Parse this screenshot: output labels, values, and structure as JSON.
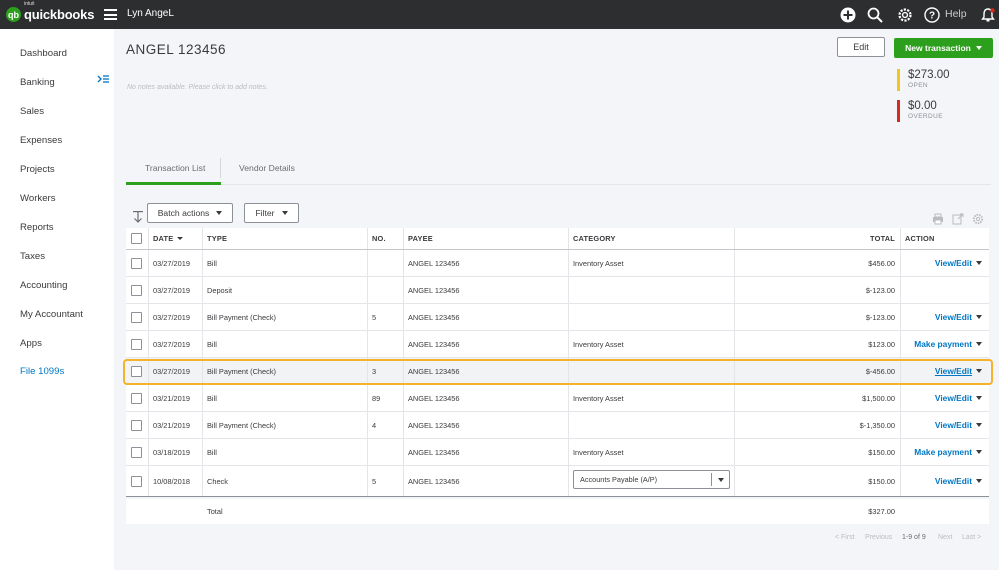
{
  "topbar": {
    "logo_small": "intuit",
    "logo_main": "quickbooks",
    "company": "Lyn AngeL",
    "help_label": "Help",
    "icons": [
      "plus-circle-icon",
      "search-icon",
      "gear-icon",
      "help-icon",
      "bell-icon"
    ]
  },
  "sidebar": {
    "items": [
      {
        "label": "Dashboard"
      },
      {
        "label": "Banking"
      },
      {
        "label": "Sales"
      },
      {
        "label": "Expenses"
      },
      {
        "label": "Projects"
      },
      {
        "label": "Workers"
      },
      {
        "label": "Reports"
      },
      {
        "label": "Taxes"
      },
      {
        "label": "Accounting"
      },
      {
        "label": "My Accountant"
      },
      {
        "label": "Apps"
      },
      {
        "label": "File 1099s"
      }
    ]
  },
  "vendor": {
    "name": "ANGEL 123456",
    "notes_placeholder": "No notes available. Please click to add notes.",
    "edit_label": "Edit",
    "new_transaction_label": "New transaction",
    "open_amount": "$273.00",
    "open_label": "OPEN",
    "overdue_amount": "$0.00",
    "overdue_label": "OVERDUE"
  },
  "colors": {
    "brand_green": "#2ca01c",
    "link_blue": "#0077c5",
    "open_bar": "#f5c518",
    "overdue_bar": "#d52b1e",
    "highlight": "#f5b22b"
  },
  "tabs": [
    {
      "label": "Transaction List"
    },
    {
      "label": "Vendor Details"
    }
  ],
  "toolbar": {
    "batch_label": "Batch actions",
    "filter_label": "Filter"
  },
  "table": {
    "headers": {
      "date": "DATE",
      "type": "TYPE",
      "no": "NO.",
      "payee": "PAYEE",
      "category": "CATEGORY",
      "total": "TOTAL",
      "action": "ACTION"
    },
    "rows": [
      {
        "date": "03/27/2019",
        "type": "Bill",
        "no": "",
        "payee": "ANGEL 123456",
        "category": "Inventory Asset",
        "total": "$456.00",
        "action": "View/Edit"
      },
      {
        "date": "03/27/2019",
        "type": "Deposit",
        "no": "",
        "payee": "ANGEL 123456",
        "category": "",
        "total": "$-123.00",
        "action": ""
      },
      {
        "date": "03/27/2019",
        "type": "Bill Payment (Check)",
        "no": "5",
        "payee": "ANGEL 123456",
        "category": "",
        "total": "$-123.00",
        "action": "View/Edit"
      },
      {
        "date": "03/27/2019",
        "type": "Bill",
        "no": "",
        "payee": "ANGEL 123456",
        "category": "Inventory Asset",
        "total": "$123.00",
        "action": "Make payment"
      },
      {
        "date": "03/27/2019",
        "type": "Bill Payment (Check)",
        "no": "3",
        "payee": "ANGEL 123456",
        "category": "",
        "total": "$-456.00",
        "action": "View/Edit"
      },
      {
        "date": "03/21/2019",
        "type": "Bill",
        "no": "89",
        "payee": "ANGEL 123456",
        "category": "Inventory Asset",
        "total": "$1,500.00",
        "action": "View/Edit"
      },
      {
        "date": "03/21/2019",
        "type": "Bill Payment (Check)",
        "no": "4",
        "payee": "ANGEL 123456",
        "category": "",
        "total": "$-1,350.00",
        "action": "View/Edit"
      },
      {
        "date": "03/18/2019",
        "type": "Bill",
        "no": "",
        "payee": "ANGEL 123456",
        "category": "Inventory Asset",
        "total": "$150.00",
        "action": "Make payment"
      },
      {
        "date": "10/08/2018",
        "type": "Check",
        "no": "5",
        "payee": "ANGEL 123456",
        "category": "Accounts Payable (A/P)",
        "total": "$150.00",
        "action": "View/Edit"
      }
    ],
    "footer_label": "Total",
    "footer_total": "$327.00"
  },
  "pagination": {
    "first": "< First",
    "previous": "Previous",
    "range": "1-9 of 9",
    "next": "Next",
    "last": "Last >"
  }
}
